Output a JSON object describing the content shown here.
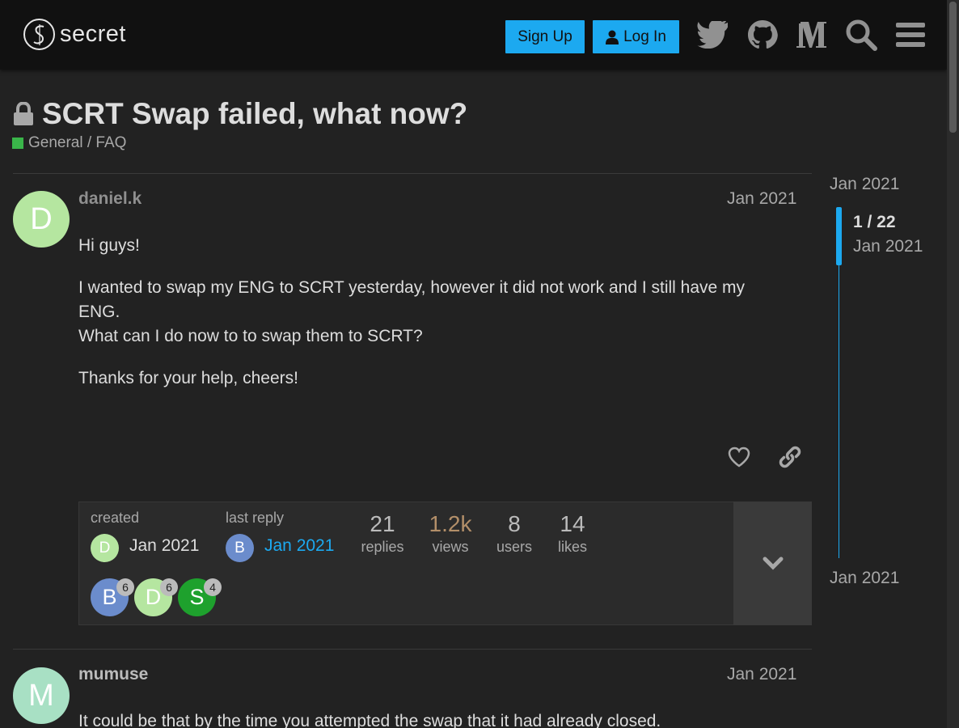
{
  "header": {
    "logo_text": "secret",
    "signup_label": "Sign Up",
    "login_label": "Log In",
    "icons": [
      "twitter-icon",
      "github-icon",
      "medium-icon",
      "search-icon",
      "hamburger-menu-icon"
    ]
  },
  "topic": {
    "title": "SCRT Swap failed, what now?",
    "category": "General / FAQ",
    "category_color": "#3ab54a"
  },
  "posts": [
    {
      "avatar_letter": "D",
      "avatar_color": "#b5e6a0",
      "username": "daniel.k",
      "username_color": "#8f8f8f",
      "date": "Jan 2021",
      "paragraphs": [
        "Hi guys!",
        "I wanted to swap my ENG to SCRT yesterday, however it did not work and I still have my ENG.",
        "What can I do now to to swap them to SCRT?",
        "Thanks for your help, cheers!"
      ]
    },
    {
      "avatar_letter": "M",
      "avatar_color": "#a8e0c4",
      "username": "mumuse",
      "username_color": "#bbbbbb",
      "date": "Jan 2021",
      "first_line": "It could be that by the time you attempted the swap that it had already closed."
    }
  ],
  "topic_map": {
    "created_label": "created",
    "created_date": "Jan 2021",
    "created_avatar": "D",
    "last_reply_label": "last reply",
    "last_reply_date": "Jan 2021",
    "last_reply_avatar": "B",
    "stats": [
      {
        "num": "21",
        "label": "replies"
      },
      {
        "num": "1.2k",
        "label": "views"
      },
      {
        "num": "8",
        "label": "users"
      },
      {
        "num": "14",
        "label": "likes"
      }
    ],
    "participants": [
      {
        "letter": "B",
        "count": "6",
        "color": "#6b8ccc"
      },
      {
        "letter": "D",
        "count": "6",
        "color": "#b5e6a0"
      },
      {
        "letter": "S",
        "count": "4",
        "color": "#1ea12d"
      }
    ]
  },
  "timeline": {
    "start_date": "Jan 2021",
    "position": "1 / 22",
    "current_date": "Jan 2021",
    "end_date": "Jan 2021"
  }
}
